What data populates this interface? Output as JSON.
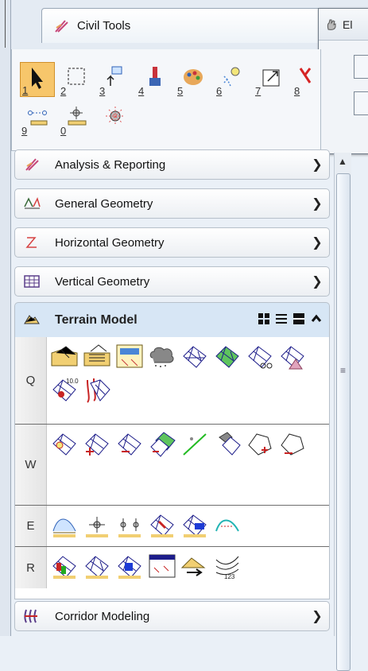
{
  "window": {
    "tab_title": "Civil Tools",
    "float_title": "El"
  },
  "tools": {
    "numbers": [
      "1",
      "2",
      "3",
      "4",
      "5",
      "6",
      "7",
      "8",
      "9",
      "0"
    ]
  },
  "sections": [
    {
      "label": "Analysis & Reporting",
      "icon": "civil-tools-icon",
      "state": "collapsed"
    },
    {
      "label": "General Geometry",
      "icon": "general-geometry-icon",
      "state": "collapsed"
    },
    {
      "label": "Horizontal Geometry",
      "icon": "horizontal-geometry-icon",
      "state": "collapsed"
    },
    {
      "label": "Vertical Geometry",
      "icon": "vertical-geometry-icon",
      "state": "collapsed"
    }
  ],
  "terrain": {
    "label": "Terrain Model",
    "groups": [
      {
        "label": "Q",
        "count": 10
      },
      {
        "label": "W",
        "count": 8
      },
      {
        "label": "E",
        "count": 6
      },
      {
        "label": "R",
        "count": 6
      }
    ]
  },
  "footer_section": {
    "label": "Corridor Modeling",
    "icon": "corridor-modeling-icon"
  },
  "colors": {
    "accent": "#f7c66b",
    "panel": "#eaf0f7",
    "header_expanded": "#d7e6f5"
  }
}
